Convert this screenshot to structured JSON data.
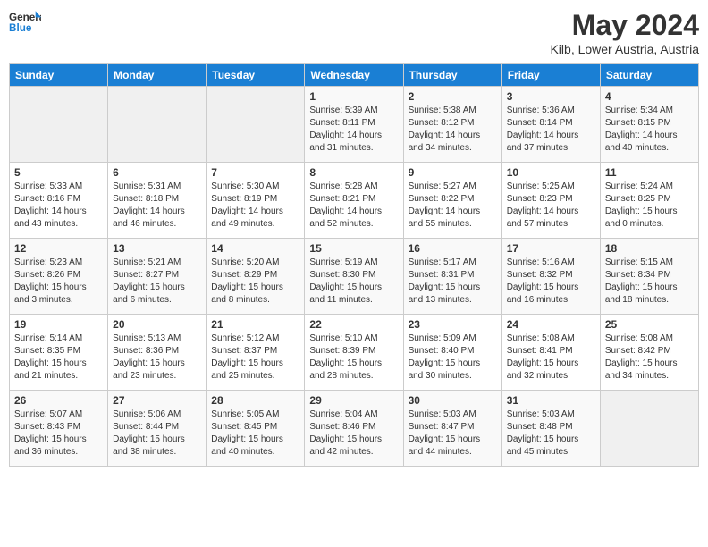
{
  "header": {
    "logo_line1": "General",
    "logo_line2": "Blue",
    "month_year": "May 2024",
    "location": "Kilb, Lower Austria, Austria"
  },
  "weekdays": [
    "Sunday",
    "Monday",
    "Tuesday",
    "Wednesday",
    "Thursday",
    "Friday",
    "Saturday"
  ],
  "weeks": [
    [
      {
        "day": "",
        "info": ""
      },
      {
        "day": "",
        "info": ""
      },
      {
        "day": "",
        "info": ""
      },
      {
        "day": "1",
        "info": "Sunrise: 5:39 AM\nSunset: 8:11 PM\nDaylight: 14 hours\nand 31 minutes."
      },
      {
        "day": "2",
        "info": "Sunrise: 5:38 AM\nSunset: 8:12 PM\nDaylight: 14 hours\nand 34 minutes."
      },
      {
        "day": "3",
        "info": "Sunrise: 5:36 AM\nSunset: 8:14 PM\nDaylight: 14 hours\nand 37 minutes."
      },
      {
        "day": "4",
        "info": "Sunrise: 5:34 AM\nSunset: 8:15 PM\nDaylight: 14 hours\nand 40 minutes."
      }
    ],
    [
      {
        "day": "5",
        "info": "Sunrise: 5:33 AM\nSunset: 8:16 PM\nDaylight: 14 hours\nand 43 minutes."
      },
      {
        "day": "6",
        "info": "Sunrise: 5:31 AM\nSunset: 8:18 PM\nDaylight: 14 hours\nand 46 minutes."
      },
      {
        "day": "7",
        "info": "Sunrise: 5:30 AM\nSunset: 8:19 PM\nDaylight: 14 hours\nand 49 minutes."
      },
      {
        "day": "8",
        "info": "Sunrise: 5:28 AM\nSunset: 8:21 PM\nDaylight: 14 hours\nand 52 minutes."
      },
      {
        "day": "9",
        "info": "Sunrise: 5:27 AM\nSunset: 8:22 PM\nDaylight: 14 hours\nand 55 minutes."
      },
      {
        "day": "10",
        "info": "Sunrise: 5:25 AM\nSunset: 8:23 PM\nDaylight: 14 hours\nand 57 minutes."
      },
      {
        "day": "11",
        "info": "Sunrise: 5:24 AM\nSunset: 8:25 PM\nDaylight: 15 hours\nand 0 minutes."
      }
    ],
    [
      {
        "day": "12",
        "info": "Sunrise: 5:23 AM\nSunset: 8:26 PM\nDaylight: 15 hours\nand 3 minutes."
      },
      {
        "day": "13",
        "info": "Sunrise: 5:21 AM\nSunset: 8:27 PM\nDaylight: 15 hours\nand 6 minutes."
      },
      {
        "day": "14",
        "info": "Sunrise: 5:20 AM\nSunset: 8:29 PM\nDaylight: 15 hours\nand 8 minutes."
      },
      {
        "day": "15",
        "info": "Sunrise: 5:19 AM\nSunset: 8:30 PM\nDaylight: 15 hours\nand 11 minutes."
      },
      {
        "day": "16",
        "info": "Sunrise: 5:17 AM\nSunset: 8:31 PM\nDaylight: 15 hours\nand 13 minutes."
      },
      {
        "day": "17",
        "info": "Sunrise: 5:16 AM\nSunset: 8:32 PM\nDaylight: 15 hours\nand 16 minutes."
      },
      {
        "day": "18",
        "info": "Sunrise: 5:15 AM\nSunset: 8:34 PM\nDaylight: 15 hours\nand 18 minutes."
      }
    ],
    [
      {
        "day": "19",
        "info": "Sunrise: 5:14 AM\nSunset: 8:35 PM\nDaylight: 15 hours\nand 21 minutes."
      },
      {
        "day": "20",
        "info": "Sunrise: 5:13 AM\nSunset: 8:36 PM\nDaylight: 15 hours\nand 23 minutes."
      },
      {
        "day": "21",
        "info": "Sunrise: 5:12 AM\nSunset: 8:37 PM\nDaylight: 15 hours\nand 25 minutes."
      },
      {
        "day": "22",
        "info": "Sunrise: 5:10 AM\nSunset: 8:39 PM\nDaylight: 15 hours\nand 28 minutes."
      },
      {
        "day": "23",
        "info": "Sunrise: 5:09 AM\nSunset: 8:40 PM\nDaylight: 15 hours\nand 30 minutes."
      },
      {
        "day": "24",
        "info": "Sunrise: 5:08 AM\nSunset: 8:41 PM\nDaylight: 15 hours\nand 32 minutes."
      },
      {
        "day": "25",
        "info": "Sunrise: 5:08 AM\nSunset: 8:42 PM\nDaylight: 15 hours\nand 34 minutes."
      }
    ],
    [
      {
        "day": "26",
        "info": "Sunrise: 5:07 AM\nSunset: 8:43 PM\nDaylight: 15 hours\nand 36 minutes."
      },
      {
        "day": "27",
        "info": "Sunrise: 5:06 AM\nSunset: 8:44 PM\nDaylight: 15 hours\nand 38 minutes."
      },
      {
        "day": "28",
        "info": "Sunrise: 5:05 AM\nSunset: 8:45 PM\nDaylight: 15 hours\nand 40 minutes."
      },
      {
        "day": "29",
        "info": "Sunrise: 5:04 AM\nSunset: 8:46 PM\nDaylight: 15 hours\nand 42 minutes."
      },
      {
        "day": "30",
        "info": "Sunrise: 5:03 AM\nSunset: 8:47 PM\nDaylight: 15 hours\nand 44 minutes."
      },
      {
        "day": "31",
        "info": "Sunrise: 5:03 AM\nSunset: 8:48 PM\nDaylight: 15 hours\nand 45 minutes."
      },
      {
        "day": "",
        "info": ""
      }
    ]
  ]
}
